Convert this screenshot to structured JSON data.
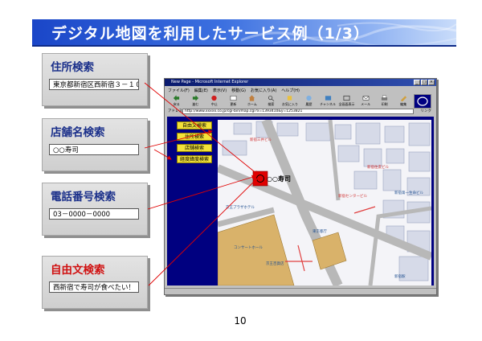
{
  "slide": {
    "title": "デジタル地図を利用したサービス例（1/3）",
    "page_number": "10"
  },
  "panels": [
    {
      "title": "住所検索",
      "value": "東京都新宿区西新宿３－１０",
      "title_color": "#1a2f8a"
    },
    {
      "title": "店舗名検索",
      "value": "○○寿司",
      "title_color": "#1a2f8a"
    },
    {
      "title": "電話番号検索",
      "value": "03－0000－0000",
      "title_color": "#1a2f8a"
    },
    {
      "title": "自由文検索",
      "value": "西新宿で寿司が食べたい！",
      "title_color": "#d01010"
    }
  ],
  "browser": {
    "window_title": "New Page - Microsoft Internet Explorer",
    "menu": [
      "ファイル(F)",
      "編集(E)",
      "表示(V)",
      "移動(G)",
      "お気に入り(A)",
      "ヘルプ(H)"
    ],
    "toolbar": [
      "戻る",
      "進む",
      "中止",
      "更新",
      "ホーム",
      "検索",
      "お気に入り",
      "履歴",
      "チャンネル",
      "全画面表示",
      "メール",
      "印刷",
      "編集"
    ],
    "address_label": "アドレス",
    "address_url": "http://www.xxxxx.co.jp/cgi-bin/map.cgi?x=1393410&y=1253821",
    "address_go": "リンク",
    "nav_items": [
      "自由文検索",
      "住所検索",
      "店舗検索",
      "経度緯度検索"
    ],
    "map": {
      "marker_label": "○○寿司",
      "labels": [
        "新宿三井ビル",
        "新宿住友ビル",
        "新宿センタービル",
        "新宿第一生命ビル",
        "京王プラザホテル",
        "コンサートホール",
        "京王百貨店",
        "東京都庁",
        "新宿駅"
      ]
    }
  },
  "colors": {
    "title_gradient_start": "#1a46c8",
    "panel_title": "#1a2f8a",
    "panel_title_alt": "#d01010",
    "browser_bg": "#000080",
    "nav_button": "#f2e23a",
    "marker": "#e00000",
    "arrow": "#e00000"
  }
}
